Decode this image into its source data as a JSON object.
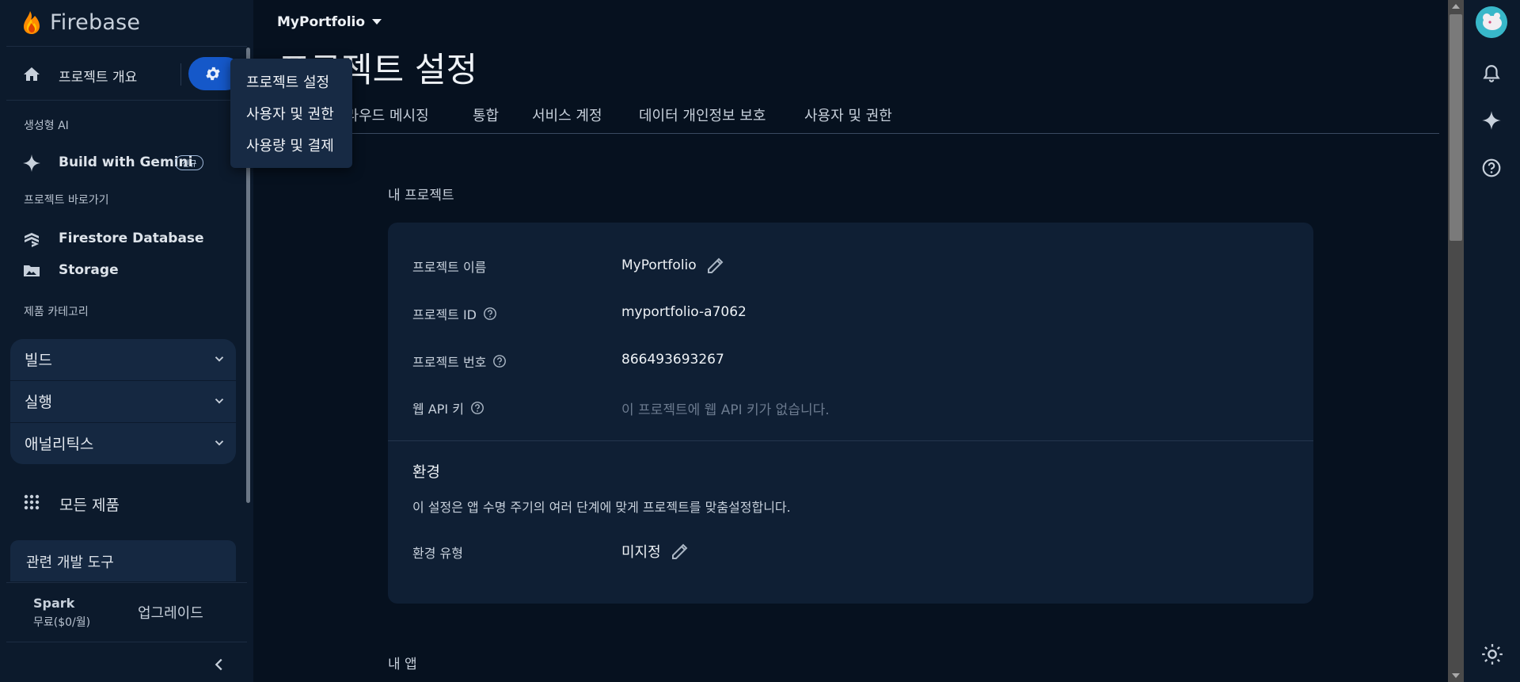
{
  "brand": {
    "name": "Firebase"
  },
  "sidebar": {
    "home_label": "프로젝트 개요",
    "section_genai": "생성형 AI",
    "gemini_label": "Build with Gemini",
    "gemini_badge": "신규",
    "section_shortcuts": "프로젝트 바로가기",
    "shortcuts": [
      {
        "label": "Firestore Database"
      },
      {
        "label": "Storage"
      }
    ],
    "section_categories": "제품 카테고리",
    "categories": [
      {
        "label": "빌드"
      },
      {
        "label": "실행"
      },
      {
        "label": "애널리틱스"
      }
    ],
    "all_products": "모든 제품",
    "dev_tools": "관련 개발 도구",
    "plan_name": "Spark",
    "plan_price": "무료($0/월)",
    "upgrade": "업그레이드"
  },
  "menu": {
    "items": [
      {
        "label": "프로젝트 설정"
      },
      {
        "label": "사용자 및 권한"
      },
      {
        "label": "사용량 및 결제"
      }
    ]
  },
  "header": {
    "project_name": "MyPortfolio",
    "page_title": "프로젝트 설정"
  },
  "tabs": [
    {
      "label": "클라우드 메시징"
    },
    {
      "label": "통합"
    },
    {
      "label": "서비스 계정"
    },
    {
      "label": "데이터 개인정보 보호"
    },
    {
      "label": "사용자 및 권한"
    }
  ],
  "project": {
    "section_title": "내 프로젝트",
    "name_label": "프로젝트 이름",
    "name_value": "MyPortfolio",
    "id_label": "프로젝트 ID",
    "id_value": "myportfolio-a7062",
    "number_label": "프로젝트 번호",
    "number_value": "866493693267",
    "api_label": "웹 API 키",
    "api_value": "이 프로젝트에 웹 API 키가 없습니다.",
    "env_title": "환경",
    "env_desc": "이 설정은 앱 수명 주기의 여러 단계에 맞게 프로젝트를 맞춤설정합니다.",
    "env_type_label": "환경 유형",
    "env_type_value": "미지정"
  },
  "apps": {
    "section_title": "내 앱"
  },
  "colors": {
    "accent": "#1558c9",
    "background": "#06111f",
    "sidebar": "#0c1a2c",
    "card": "#0f1f34"
  }
}
